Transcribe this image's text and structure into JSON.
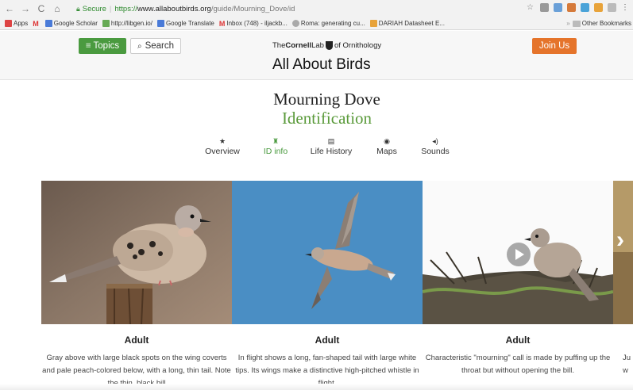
{
  "browser": {
    "secure_label": "Secure",
    "url_scheme": "https://",
    "url_domain": "www.allaboutbirds.org",
    "url_path": "/guide/Mourning_Dove/id",
    "bookmarks": [
      {
        "label": "Apps",
        "color": "#d44"
      },
      {
        "label": "",
        "color": "#d33"
      },
      {
        "label": "Google Scholar",
        "color": "#4a7bd8"
      },
      {
        "label": "http://libgen.io/",
        "color": "#6a5"
      },
      {
        "label": "Google Translate",
        "color": "#4a7bd8"
      },
      {
        "label": "Inbox (748) - iljackb...",
        "color": "#d33"
      },
      {
        "label": "Roma: generating cu...",
        "color": "#888"
      },
      {
        "label": "DARIAH Datasheet E...",
        "color": "#e8a33a"
      }
    ],
    "other_bookmarks": "Other Bookmarks"
  },
  "header": {
    "topics_label": "≡ Topics",
    "search_label": "Search",
    "lab_prefix": "The",
    "lab_bold": "Cornell",
    "lab_mid": "Lab",
    "lab_suffix": "of Ornithology",
    "site_title": "All About Birds",
    "join_label": "Join Us"
  },
  "species": {
    "name": "Mourning Dove",
    "section": "Identification"
  },
  "tabs": [
    {
      "icon": "★",
      "label": "Overview"
    },
    {
      "icon": "♜",
      "label": "ID info"
    },
    {
      "icon": "▤",
      "label": "Life History"
    },
    {
      "icon": "◉",
      "label": "Maps"
    },
    {
      "icon": "◂)",
      "label": "Sounds"
    }
  ],
  "carousel": {
    "slides": [
      {
        "title": "Adult",
        "caption": "Gray above with large black spots on the wing coverts and pale peach-colored below, with a long, thin tail. Note the thin, black bill"
      },
      {
        "title": "Adult",
        "caption": "In flight shows a long, fan-shaped tail with large white tips. Its wings make a distinctive high-pitched whistle in flight."
      },
      {
        "title": "Adult",
        "caption": "Characteristic \"mourning\" call is made by puffing up the throat but without opening the bill."
      }
    ],
    "partial_caption_1": "Ju",
    "partial_caption_2": "w",
    "prev_arrow": "‹",
    "next_arrow": "›"
  },
  "colors": {
    "accent_green": "#4a9a3f",
    "join_orange": "#e5742b",
    "sky_blue": "#4a8ec4"
  }
}
